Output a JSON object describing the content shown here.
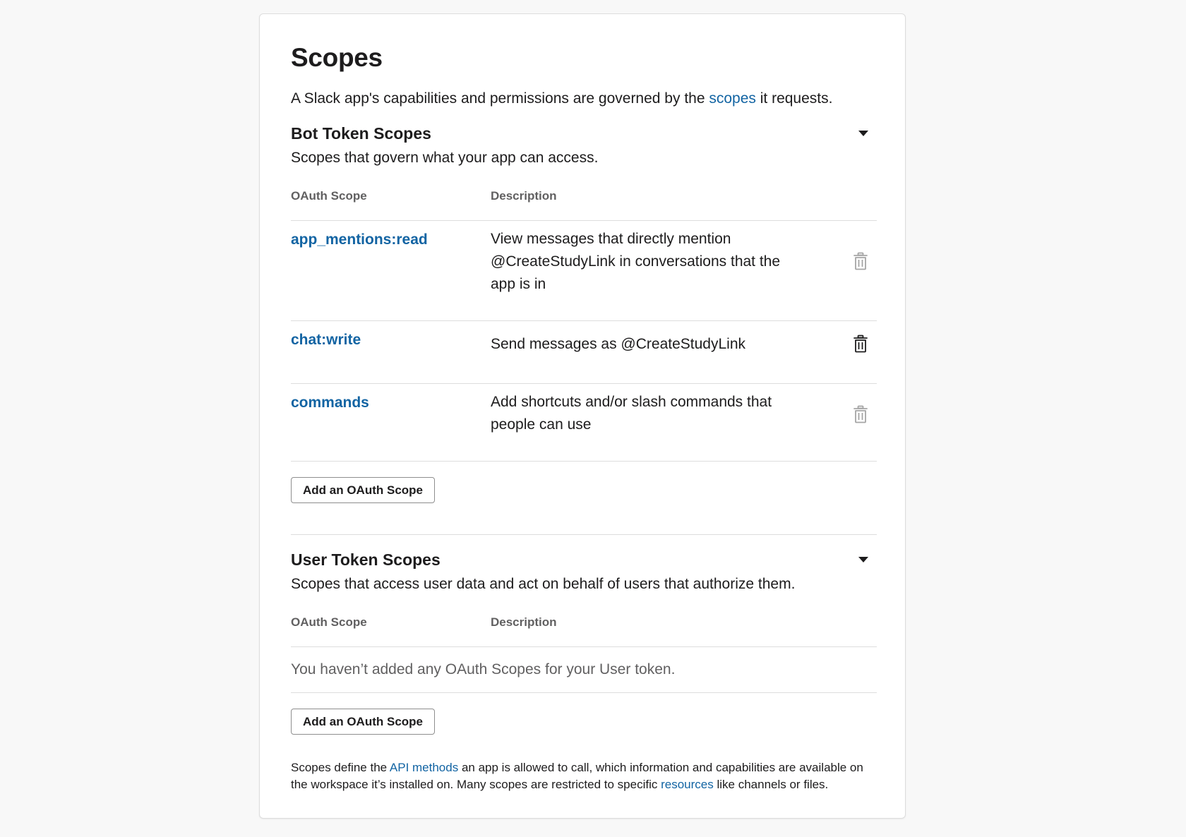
{
  "page": {
    "title": "Scopes",
    "intro_before": "A Slack app's capabilities and permissions are governed by the ",
    "intro_link": "scopes",
    "intro_after": " it requests."
  },
  "bot": {
    "title": "Bot Token Scopes",
    "subtitle": "Scopes that govern what your app can access.",
    "col_scope": "OAuth Scope",
    "col_desc": "Description",
    "rows": [
      {
        "scope": "app_mentions:read",
        "desc": "View messages that directly mention @CreateStudyLink in conversations that the app is in"
      },
      {
        "scope": "chat:write",
        "desc": "Send messages as @CreateStudyLink"
      },
      {
        "scope": "commands",
        "desc": "Add shortcuts and/or slash commands that people can use"
      }
    ],
    "add_button": "Add an OAuth Scope"
  },
  "user": {
    "title": "User Token Scopes",
    "subtitle": "Scopes that access user data and act on behalf of users that authorize them.",
    "col_scope": "OAuth Scope",
    "col_desc": "Description",
    "empty_text": "You haven’t added any OAuth Scopes for your User token.",
    "add_button": "Add an OAuth Scope"
  },
  "footer": {
    "t1": "Scopes define the ",
    "link1": "API methods",
    "t2": " an app is allowed to call, which information and capabilities are available on the workspace it’s installed on. Many scopes are restricted to specific ",
    "link2": "resources",
    "t3": " like channels or files."
  },
  "icons": {
    "collapse": "caret-down-icon",
    "remove": "trash-icon"
  },
  "colors": {
    "link": "#1264a3",
    "text": "#1d1c1d",
    "muted": "#616061",
    "border": "#dddddd",
    "background": "#f8f8f8"
  }
}
